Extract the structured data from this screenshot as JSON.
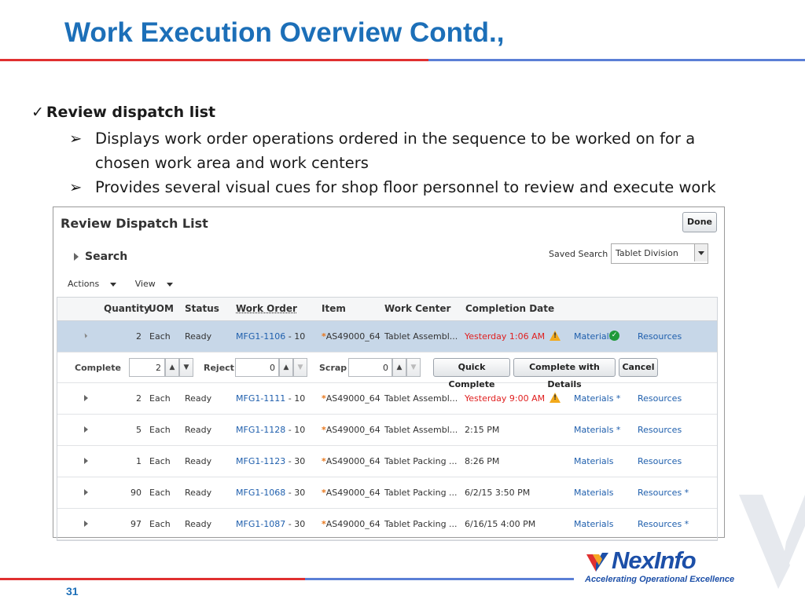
{
  "slide": {
    "title": "Work Execution Overview Contd.,",
    "page_number": "31"
  },
  "bullets": {
    "check_mark": "✓",
    "arrow": "➢",
    "main": "Review dispatch list",
    "sub": [
      "Displays work order operations ordered in the sequence to be worked on for a",
      "chosen work area and work centers",
      "Provides several visual cues for shop floor personnel to review and execute work"
    ]
  },
  "panel": {
    "title": "Review Dispatch List",
    "done_label": "Done",
    "search_label": "Search",
    "saved_search_label": "Saved Search",
    "saved_search_value": "Tablet Division",
    "actions_label": "Actions",
    "view_label": "View",
    "columns": [
      "Quantity",
      "UOM",
      "Status",
      "Work Order",
      "Item",
      "Work Center",
      "Completion Date"
    ],
    "selected_row": {
      "quantity": "2",
      "uom": "Each",
      "status": "Ready",
      "work_order": "MFG1-1106",
      "op": " - 10",
      "item": "AS49000_64",
      "work_center": "Tablet Assembl...",
      "completion": "Yesterday 1:06 AM",
      "materials": "Materials",
      "resources": "Resources"
    },
    "complete_row": {
      "complete_label": "Complete",
      "complete_value": "2",
      "reject_label": "Reject",
      "reject_value": "0",
      "scrap_label": "Scrap",
      "scrap_value": "0",
      "quick_complete": "Quick Complete",
      "complete_details": "Complete with Details",
      "cancel": "Cancel"
    },
    "rows": [
      {
        "quantity": "2",
        "uom": "Each",
        "status": "Ready",
        "work_order": "MFG1-1111",
        "op": " - 10",
        "item": "AS49000_64",
        "work_center": "Tablet Assembl...",
        "completion": "Yesterday 9:00 AM",
        "materials": "Materials *",
        "resources": "Resources"
      },
      {
        "quantity": "5",
        "uom": "Each",
        "status": "Ready",
        "work_order": "MFG1-1128",
        "op": " - 10",
        "item": "AS49000_64",
        "work_center": "Tablet Assembl...",
        "completion": "2:15 PM",
        "materials": "Materials *",
        "resources": "Resources"
      },
      {
        "quantity": "1",
        "uom": "Each",
        "status": "Ready",
        "work_order": "MFG1-1123",
        "op": " - 30",
        "item": "AS49000_64",
        "work_center": "Tablet Packing ...",
        "completion": "8:26 PM",
        "materials": "Materials",
        "resources": "Resources"
      },
      {
        "quantity": "90",
        "uom": "Each",
        "status": "Ready",
        "work_order": "MFG1-1068",
        "op": " - 30",
        "item": "AS49000_64",
        "work_center": "Tablet Packing ...",
        "completion": "6/2/15 3:50 PM",
        "materials": "Materials",
        "resources": "Resources *"
      },
      {
        "quantity": "97",
        "uom": "Each",
        "status": "Ready",
        "work_order": "MFG1-1087",
        "op": " - 30",
        "item": "AS49000_64",
        "work_center": "Tablet Packing ...",
        "completion": "6/16/15 4:00 PM",
        "materials": "Materials",
        "resources": "Resources *"
      }
    ]
  },
  "logo": {
    "name_part1": "Nex",
    "name_part2": "Info",
    "tagline": "Accelerating Operational Excellence"
  },
  "colors": {
    "title_blue": "#1c6fb8",
    "rule_red": "#e03030",
    "rule_blue": "#5b7fd6",
    "link_blue": "#1f5fad",
    "late_red": "#e02020",
    "selected_row": "#c7d7e8"
  },
  "icons": [
    "check-icon",
    "arrow-bullet-icon",
    "expand-icon",
    "warning-icon",
    "ok-check-icon",
    "spin-up-icon",
    "spin-down-icon",
    "dropdown-icon"
  ]
}
